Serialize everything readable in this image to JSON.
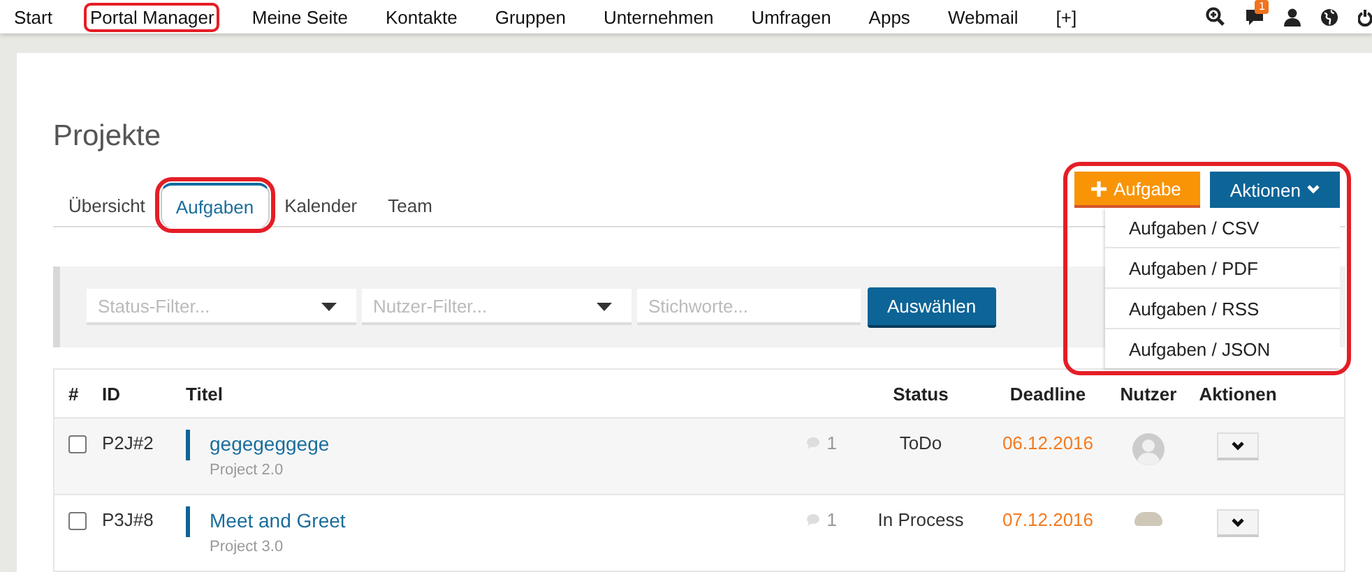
{
  "nav": {
    "items": [
      {
        "label": "Start",
        "highlighted": false
      },
      {
        "label": "Portal Manager",
        "highlighted": true
      },
      {
        "label": "Meine Seite",
        "highlighted": false
      },
      {
        "label": "Kontakte",
        "highlighted": false
      },
      {
        "label": "Gruppen",
        "highlighted": false
      },
      {
        "label": "Unternehmen",
        "highlighted": false
      },
      {
        "label": "Umfragen",
        "highlighted": false
      },
      {
        "label": "Apps",
        "highlighted": false
      },
      {
        "label": "Webmail",
        "highlighted": false
      },
      {
        "label": "[+]",
        "highlighted": false
      }
    ],
    "message_badge": "1"
  },
  "page": {
    "title": "Projekte",
    "tabs": [
      {
        "label": "Übersicht",
        "selected": false,
        "highlighted": false
      },
      {
        "label": "Aufgaben",
        "selected": true,
        "highlighted": true
      },
      {
        "label": "Kalender",
        "selected": false,
        "highlighted": false
      },
      {
        "label": "Team",
        "selected": false,
        "highlighted": false
      }
    ],
    "add_button": "Aufgabe",
    "actions_button": "Aktionen",
    "actions_menu": {
      "expanded": true,
      "highlighted": true,
      "items": [
        "Aufgaben / CSV",
        "Aufgaben / PDF",
        "Aufgaben / RSS",
        "Aufgaben / JSON"
      ]
    },
    "filters": {
      "status": {
        "placeholder": "Status-Filter..."
      },
      "user": {
        "placeholder": "Nutzer-Filter..."
      },
      "keywords": {
        "placeholder": "Stichworte..."
      },
      "submit": "Auswählen"
    },
    "table": {
      "columns": [
        "#",
        "ID",
        "Titel",
        "Status",
        "Deadline",
        "Nutzer",
        "Aktionen"
      ],
      "rows": [
        {
          "checked": false,
          "id": "P2J#2",
          "title": "gegegeggege",
          "project": "Project 2.0",
          "comments": "1",
          "status": "ToDo",
          "deadline": "06.12.2016",
          "avatar": {
            "kind": "silhouette"
          }
        },
        {
          "checked": false,
          "id": "P3J#8",
          "title": "Meet and Greet",
          "project": "Project 3.0",
          "comments": "1",
          "status": "In Process",
          "deadline": "07.12.2016",
          "avatar": {
            "kind": "picture"
          }
        }
      ]
    }
  }
}
